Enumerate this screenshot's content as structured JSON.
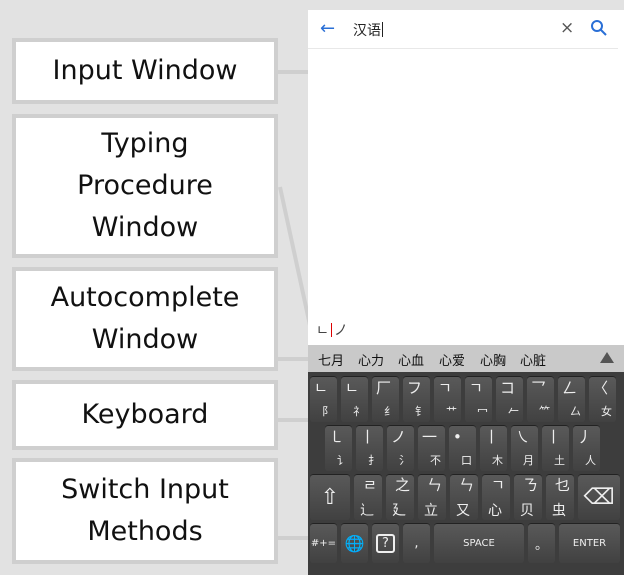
{
  "labels": {
    "input_window": "Input Window",
    "typing_procedure": [
      "Typing",
      "Procedure",
      "Window"
    ],
    "autocomplete": [
      "Autocomplete",
      "Window"
    ],
    "keyboard": "Keyboard",
    "switch_input": [
      "Switch Input",
      "Methods"
    ]
  },
  "search": {
    "back_icon": "←",
    "query": "汉语",
    "clear_icon": "×"
  },
  "procedure": {
    "left": "ㄴ",
    "right": "ノ"
  },
  "autocomplete": {
    "items": [
      "七月",
      "心力",
      "心血",
      "心爱",
      "心胸",
      "心脏"
    ],
    "more_icon": "▲"
  },
  "keyboard": {
    "row1": [
      {
        "a": "ㄴ",
        "b": "阝"
      },
      {
        "a": "ㄴ",
        "b": "礻"
      },
      {
        "a": "厂",
        "b": "纟"
      },
      {
        "a": "フ",
        "b": "钅"
      },
      {
        "a": "ㄱ",
        "b": "艹"
      },
      {
        "a": "ㄱ",
        "b": "冖"
      },
      {
        "a": "コ",
        "b": "𠂉"
      },
      {
        "a": "乛",
        "b": "⺮"
      },
      {
        "a": "ㄥ",
        "b": "厶"
      },
      {
        "a": "〈",
        "b": "女"
      }
    ],
    "row2": [
      {
        "a": "㇄",
        "b": "讠"
      },
      {
        "a": "丨",
        "b": "扌"
      },
      {
        "a": "ノ",
        "b": "氵"
      },
      {
        "a": "一",
        "b": "不"
      },
      {
        "a": "•",
        "b": "口"
      },
      {
        "a": "丨",
        "b": "木"
      },
      {
        "a": "㇏",
        "b": "月"
      },
      {
        "a": "丨",
        "b": "土"
      },
      {
        "a": "丿",
        "b": "人"
      }
    ],
    "row3": [
      {
        "a": "ㄹ",
        "b": "辶"
      },
      {
        "a": "之",
        "b": "廴"
      },
      {
        "a": "ㄣ",
        "b": "立"
      },
      {
        "a": "ㄣ",
        "b": "又"
      },
      {
        "a": "ㄱ",
        "b": "心"
      },
      {
        "a": "ㄋ",
        "b": "贝"
      },
      {
        "a": "乜",
        "b": "虫"
      }
    ],
    "shift_icon": "⇧",
    "backspace_icon": "⌫",
    "sym": "#+=",
    "globe_icon": "🌐",
    "help_icon": "?",
    "comma": ",",
    "space": "SPACE",
    "period": "。",
    "enter": "ENTER"
  }
}
